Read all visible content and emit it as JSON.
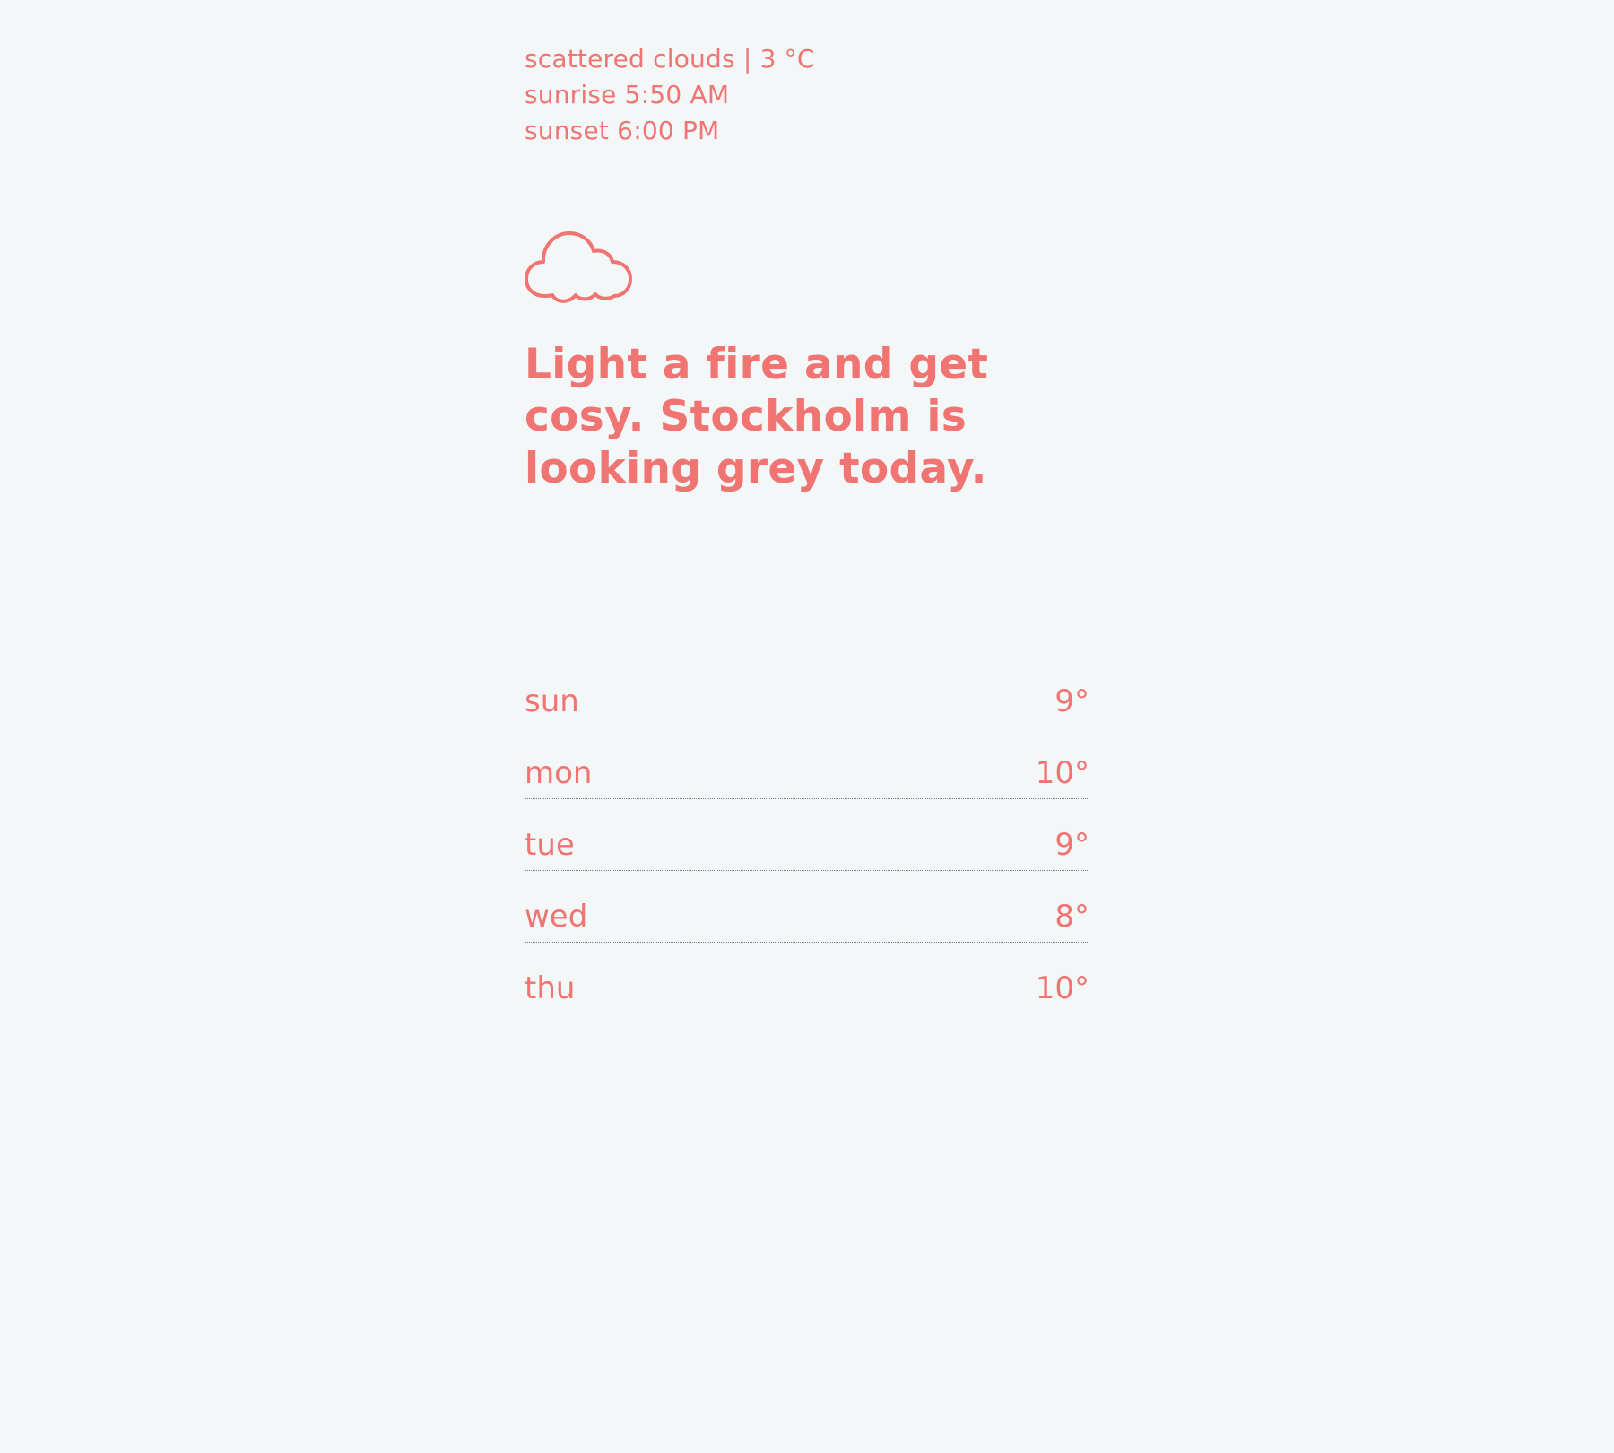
{
  "summary": {
    "condition": "scattered clouds | 3 °C",
    "sunrise": "sunrise 5:50 AM",
    "sunset": "sunset 6:00 PM"
  },
  "icon": "cloud-icon",
  "headline": "Light a fire and get cosy. Stockholm is looking grey today.",
  "forecast": [
    {
      "day": "sun",
      "temp": "9°"
    },
    {
      "day": "mon",
      "temp": "10°"
    },
    {
      "day": "tue",
      "temp": "9°"
    },
    {
      "day": "wed",
      "temp": "8°"
    },
    {
      "day": "thu",
      "temp": "10°"
    }
  ],
  "colors": {
    "accent": "#f07471",
    "background": "#f3f7f8",
    "divider": "#6b7a8c"
  }
}
